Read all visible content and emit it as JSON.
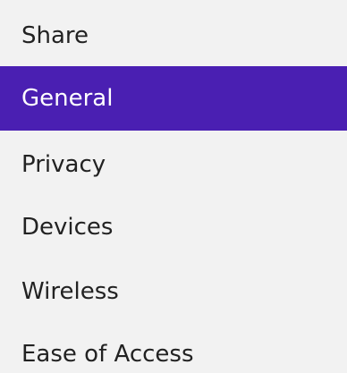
{
  "menu": {
    "items": [
      {
        "label": "Share"
      },
      {
        "label": "General"
      },
      {
        "label": "Privacy"
      },
      {
        "label": "Devices"
      },
      {
        "label": "Wireless"
      },
      {
        "label": "Ease of Access"
      }
    ],
    "selected_index": 1,
    "selected_color": "#4a1fb2",
    "background_color": "#f2f2f2"
  }
}
